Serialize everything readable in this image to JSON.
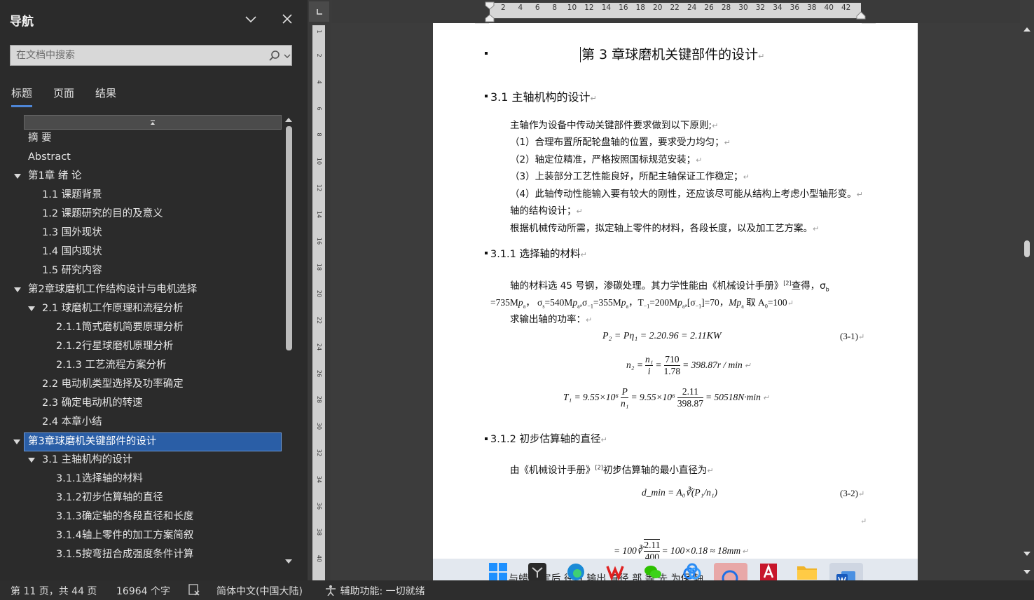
{
  "nav": {
    "title": "导航",
    "search_placeholder": "在文档中搜索",
    "tabs": [
      "标题",
      "页面",
      "结果"
    ],
    "items": [
      {
        "label": "摘  要",
        "level": 1,
        "expandable": false
      },
      {
        "label": "Abstract",
        "level": 1,
        "expandable": false
      },
      {
        "label": "第1章 绪  论",
        "level": 1,
        "expandable": true
      },
      {
        "label": "1.1 课题背景",
        "level": 2,
        "expandable": false
      },
      {
        "label": "1.2 课题研究的目的及意义",
        "level": 2,
        "expandable": false
      },
      {
        "label": "1.3 国外现状",
        "level": 2,
        "expandable": false
      },
      {
        "label": "1.4 国内现状",
        "level": 2,
        "expandable": false
      },
      {
        "label": "1.5 研究内容",
        "level": 2,
        "expandable": false
      },
      {
        "label": "第2章球磨机工作结构设计与电机选择",
        "level": 1,
        "expandable": true
      },
      {
        "label": "2.1 球磨机工作原理和流程分析",
        "level": 2,
        "expandable": true
      },
      {
        "label": "2.1.1筒式磨机简要原理分析",
        "level": 3,
        "expandable": false
      },
      {
        "label": "2.1.2行星球磨机原理分析",
        "level": 3,
        "expandable": false
      },
      {
        "label": "2.1.3 工艺流程方案分析",
        "level": 3,
        "expandable": false
      },
      {
        "label": "2.2 电动机类型选择及功率确定",
        "level": 2,
        "expandable": false
      },
      {
        "label": "2.3 确定电动机的转速",
        "level": 2,
        "expandable": false
      },
      {
        "label": "2.4 本章小结",
        "level": 2,
        "expandable": false
      },
      {
        "label": "第3章球磨机关键部件的设计",
        "level": 1,
        "expandable": true,
        "selected": true
      },
      {
        "label": "3.1 主轴机构的设计",
        "level": 2,
        "expandable": true
      },
      {
        "label": "3.1.1选择轴的材料",
        "level": 3,
        "expandable": false
      },
      {
        "label": "3.1.2初步估算轴的直径",
        "level": 3,
        "expandable": false
      },
      {
        "label": "3.1.3确定轴的各段直径和长度",
        "level": 3,
        "expandable": false
      },
      {
        "label": "3.1.4轴上零件的加工方案简叙",
        "level": 3,
        "expandable": false
      },
      {
        "label": "3.1.5按弯扭合成强度条件计算",
        "level": 3,
        "expandable": false
      }
    ]
  },
  "ruler": {
    "h_ticks": [
      "2",
      "4",
      "6",
      "8",
      "10",
      "12",
      "14",
      "16",
      "18",
      "20",
      "22",
      "24",
      "26",
      "28",
      "30",
      "32",
      "34",
      "36",
      "38",
      "40",
      "42"
    ],
    "v_ticks": [
      "1",
      "2",
      "4",
      "6",
      "8",
      "10",
      "12",
      "14",
      "16",
      "18",
      "20",
      "22",
      "24",
      "26",
      "28",
      "30",
      "32",
      "34",
      "36",
      "38",
      "40"
    ]
  },
  "doc": {
    "chapter_title": "第 3 章球磨机关键部件的设计",
    "h_3_1": "3.1 主轴机构的设计",
    "p_intro": "主轴作为设备中传动关键部件要求做到以下原则;",
    "p_1": "（1）合理布置所配轮盘轴的位置，要求受力均匀；",
    "p_2": "（2）轴定位精准，严格按照国标规范安装；",
    "p_3": "（3）上装部分工艺性能良好，所配主轴保证工作稳定；",
    "p_4": "（4）此轴传动性能输入要有较大的刚性，还应该尽可能从结构上考虑小型轴形变。",
    "p_5": "轴的结构设计；",
    "p_6": "根据机械传动所需，拟定轴上零件的材料，各段长度，以及加工艺方案。",
    "h_3_1_1": "3.1.1 选择轴的材料",
    "p_mat_1": "轴的材料选 45 号钢，渗碳处理。其力学性能由《机械设计手册》",
    "p_mat_ref": "[2]",
    "p_mat_1b": "查得，σ",
    "p_mat_2": "=735M",
    "p_mat_2b": "，  σ",
    "p_mat_2c": "=540M",
    "p_mat_2d": "σ",
    "p_mat_2e": "=355M",
    "p_mat_2f": "，T",
    "p_mat_2g": "=200M",
    "p_mat_2h": "[σ",
    "p_mat_2i": "]=70，",
    "p_mat_2j": "Mp",
    "p_mat_2k": " 取 A",
    "p_mat_2l": "=100",
    "p_power": "求输出轴的功率：",
    "eq1": "P₂ = Pη₁ = 2.20.96 = 2.11KW",
    "eq1_no": "(3-1)",
    "eq2_lhs": "n₂ =",
    "eq2_num1": "n₁",
    "eq2_den1": "i",
    "eq2_num2": "710",
    "eq2_den2": "1.78",
    "eq2_rhs": "= 398.87r / min",
    "eq3_lhs": "T₁ = 9.55×10⁶",
    "eq3_num1": "P",
    "eq3_den1": "n₁",
    "eq3_mid": "= 9.55×10⁶",
    "eq3_num2": "2.11",
    "eq3_den2": "398.87",
    "eq3_rhs": "= 50518N·min",
    "h_3_1_2": "3.1.2 初步估算轴的直径",
    "p_est": "由《机械设计手册》",
    "p_est_ref": "[2]",
    "p_est_b": "初步估算轴的最小直径为",
    "eq4": "d_min = A₀∛(P₁/n₁)",
    "eq4_no": "(3-2)",
    "eq5_a": "= 100∛",
    "eq5_num": "2.11",
    "eq5_den": "400",
    "eq5_b": "= 100×0.18 ≈ 18mm",
    "taskbar_text": "与蜡  选定后  径目  输出  直径  部  等  先  为保  轴"
  },
  "status": {
    "page": "第 11 页，共 44 页",
    "words": "16964 个字",
    "language": "简体中文(中国大陆)",
    "accessibility": "辅助功能: 一切就绪"
  }
}
